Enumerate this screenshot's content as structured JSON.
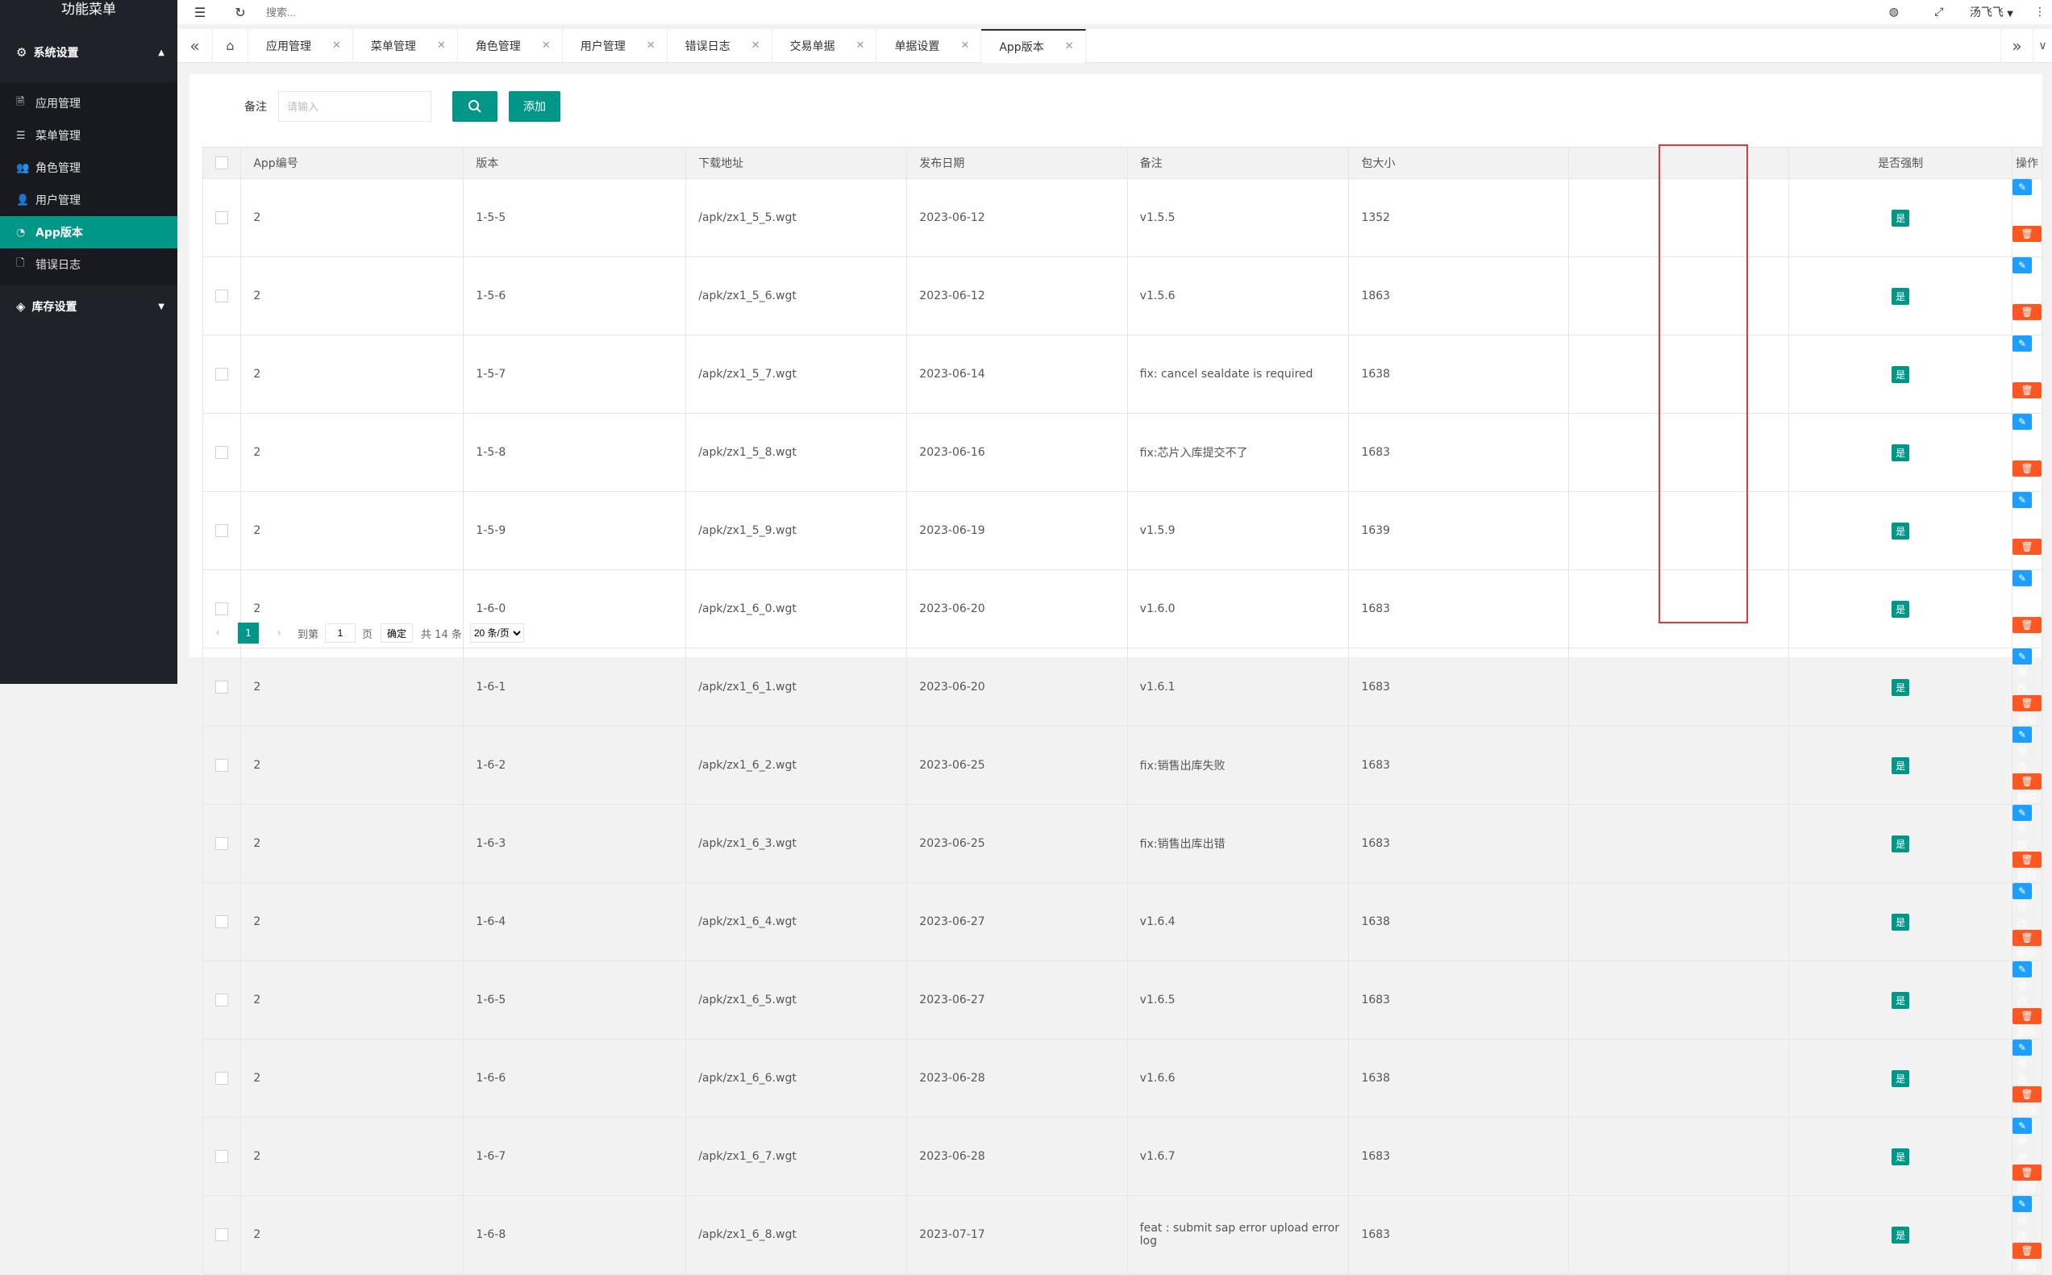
{
  "sidebar": {
    "title": "功能菜单",
    "group1": {
      "label": "系统设置",
      "icon": "gear-icon"
    },
    "items": [
      {
        "label": "应用管理",
        "icon": "doc-icon",
        "glyph": "🗎"
      },
      {
        "label": "菜单管理",
        "icon": "list-icon",
        "glyph": "☰"
      },
      {
        "label": "角色管理",
        "icon": "users-icon",
        "glyph": "👥"
      },
      {
        "label": "用户管理",
        "icon": "user-icon",
        "glyph": "👤"
      },
      {
        "label": "App版本",
        "icon": "dashboard-icon",
        "glyph": "◔"
      },
      {
        "label": "错误日志",
        "icon": "file-icon",
        "glyph": "🗋"
      }
    ],
    "group2": {
      "label": "库存设置",
      "icon": "layers-icon"
    }
  },
  "header": {
    "search_placeholder": "搜索...",
    "username": "汤飞飞"
  },
  "tabs": [
    {
      "label": "应用管理"
    },
    {
      "label": "菜单管理"
    },
    {
      "label": "角色管理"
    },
    {
      "label": "用户管理"
    },
    {
      "label": "错误日志"
    },
    {
      "label": "交易单据"
    },
    {
      "label": "单据设置"
    },
    {
      "label": "App版本"
    }
  ],
  "filter": {
    "label": "备注",
    "placeholder": "请输入",
    "add_label": "添加"
  },
  "table": {
    "headers": [
      "App编号",
      "版本",
      "下载地址",
      "发布日期",
      "备注",
      "包大小",
      "",
      "是否强制",
      "操作"
    ],
    "edit_label": "✎ 修改",
    "delete_label": "🗑 删除",
    "rows": [
      {
        "app": "2",
        "ver": "1-5-5",
        "url": "/apk/zx1_5_5.wgt",
        "date": "2023-06-12",
        "note": "v1.5.5",
        "size": "1352",
        "force": "是"
      },
      {
        "app": "2",
        "ver": "1-5-6",
        "url": "/apk/zx1_5_6.wgt",
        "date": "2023-06-12",
        "note": "v1.5.6",
        "size": "1863",
        "force": "是"
      },
      {
        "app": "2",
        "ver": "1-5-7",
        "url": "/apk/zx1_5_7.wgt",
        "date": "2023-06-14",
        "note": "fix: cancel sealdate is required",
        "size": "1638",
        "force": "是"
      },
      {
        "app": "2",
        "ver": "1-5-8",
        "url": "/apk/zx1_5_8.wgt",
        "date": "2023-06-16",
        "note": "fix:芯片入库提交不了",
        "size": "1683",
        "force": "是"
      },
      {
        "app": "2",
        "ver": "1-5-9",
        "url": "/apk/zx1_5_9.wgt",
        "date": "2023-06-19",
        "note": "v1.5.9",
        "size": "1639",
        "force": "是"
      },
      {
        "app": "2",
        "ver": "1-6-0",
        "url": "/apk/zx1_6_0.wgt",
        "date": "2023-06-20",
        "note": "v1.6.0",
        "size": "1683",
        "force": "是"
      },
      {
        "app": "2",
        "ver": "1-6-1",
        "url": "/apk/zx1_6_1.wgt",
        "date": "2023-06-20",
        "note": "v1.6.1",
        "size": "1683",
        "force": "是"
      },
      {
        "app": "2",
        "ver": "1-6-2",
        "url": "/apk/zx1_6_2.wgt",
        "date": "2023-06-25",
        "note": "fix:销售出库失败",
        "size": "1683",
        "force": "是"
      },
      {
        "app": "2",
        "ver": "1-6-3",
        "url": "/apk/zx1_6_3.wgt",
        "date": "2023-06-25",
        "note": "fix:销售出库出错",
        "size": "1683",
        "force": "是"
      },
      {
        "app": "2",
        "ver": "1-6-4",
        "url": "/apk/zx1_6_4.wgt",
        "date": "2023-06-27",
        "note": "v1.6.4",
        "size": "1638",
        "force": "是"
      },
      {
        "app": "2",
        "ver": "1-6-5",
        "url": "/apk/zx1_6_5.wgt",
        "date": "2023-06-27",
        "note": "v1.6.5",
        "size": "1683",
        "force": "是"
      },
      {
        "app": "2",
        "ver": "1-6-6",
        "url": "/apk/zx1_6_6.wgt",
        "date": "2023-06-28",
        "note": "v1.6.6",
        "size": "1638",
        "force": "是"
      },
      {
        "app": "2",
        "ver": "1-6-7",
        "url": "/apk/zx1_6_7.wgt",
        "date": "2023-06-28",
        "note": "v1.6.7",
        "size": "1683",
        "force": "是"
      },
      {
        "app": "2",
        "ver": "1-6-8",
        "url": "/apk/zx1_6_8.wgt",
        "date": "2023-07-17",
        "note": "feat : submit sap error upload error log",
        "size": "1683",
        "force": "是"
      }
    ]
  },
  "pager": {
    "current": "1",
    "goto_label": "到第",
    "page_value": "1",
    "page_unit": "页",
    "confirm": "确定",
    "total": "共 14 条",
    "page_size": "20 条/页"
  },
  "colors": {
    "accent": "#009688",
    "edit": "#1e9fff",
    "delete": "#ff5722",
    "highlight_box": "#e53935"
  }
}
